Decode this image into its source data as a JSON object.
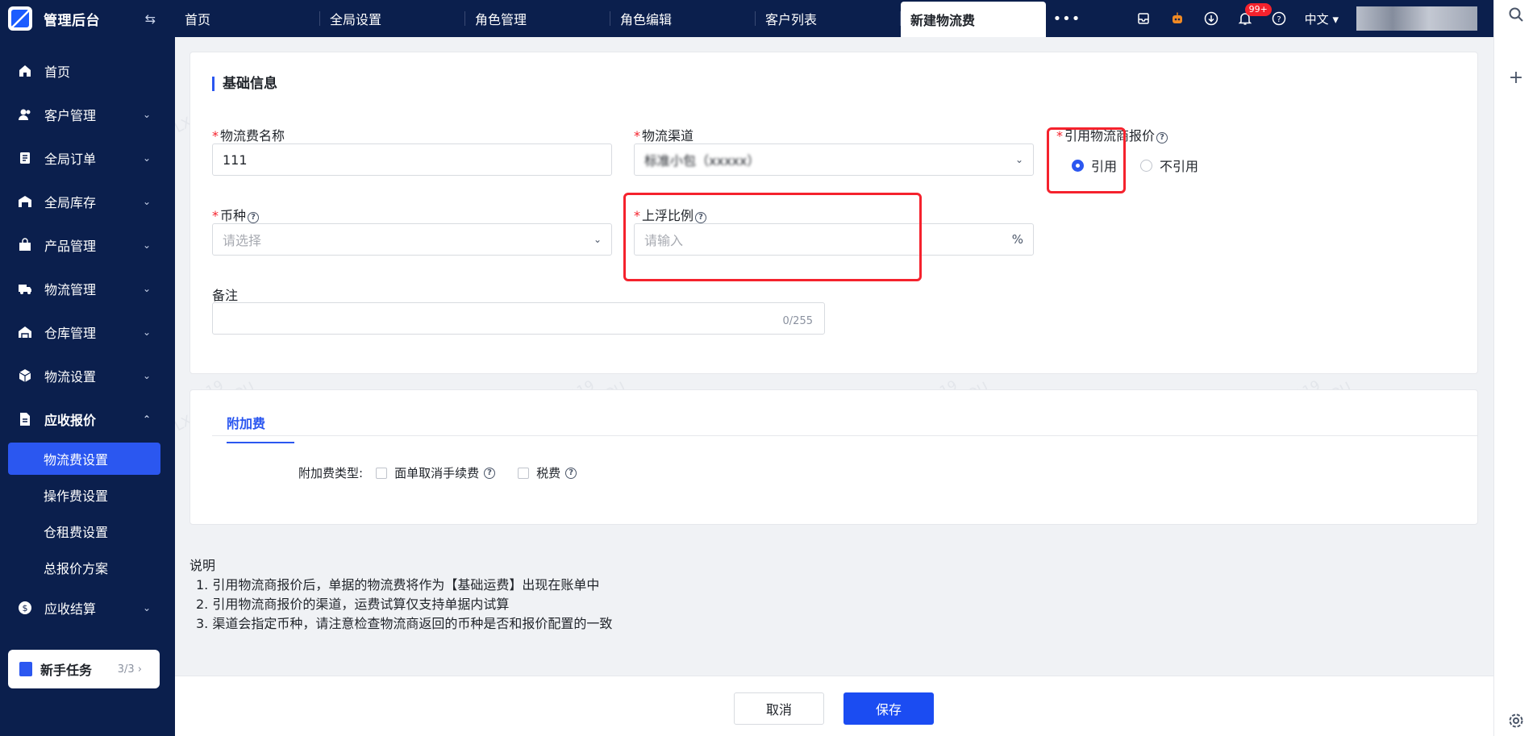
{
  "app": {
    "title": "管理后台"
  },
  "tabs": [
    {
      "label": "首页"
    },
    {
      "label": "全局设置"
    },
    {
      "label": "角色管理"
    },
    {
      "label": "角色编辑"
    },
    {
      "label": "客户列表"
    },
    {
      "label": "新建物流费",
      "active": true
    }
  ],
  "header": {
    "notification_count": "99+",
    "language": "中文"
  },
  "sidebar": {
    "items": [
      {
        "label": "首页",
        "icon": "home-icon"
      },
      {
        "label": "客户管理",
        "icon": "users-icon"
      },
      {
        "label": "全局订单",
        "icon": "order-icon"
      },
      {
        "label": "全局库存",
        "icon": "inventory-icon"
      },
      {
        "label": "产品管理",
        "icon": "product-icon"
      },
      {
        "label": "物流管理",
        "icon": "truck-icon"
      },
      {
        "label": "仓库管理",
        "icon": "warehouse-icon"
      },
      {
        "label": "物流设置",
        "icon": "box-icon"
      },
      {
        "label": "应收报价",
        "icon": "document-icon"
      },
      {
        "label": "应收结算",
        "icon": "dollar-icon"
      }
    ],
    "sub_items": [
      {
        "label": "物流费设置",
        "active": true
      },
      {
        "label": "操作费设置"
      },
      {
        "label": "仓租费设置"
      },
      {
        "label": "总报价方案"
      }
    ],
    "newbie": {
      "label": "新手任务",
      "count": "3/3"
    }
  },
  "form": {
    "section_title": "基础信息",
    "name_label": "物流费名称",
    "name_value": "111",
    "channel_label": "物流渠道",
    "channel_value": "标准小包（xxxxx）",
    "quote_label": "引用物流商报价",
    "quote_yes": "引用",
    "quote_no": "不引用",
    "currency_label": "币种",
    "currency_placeholder": "请选择",
    "markup_label": "上浮比例",
    "markup_placeholder": "请输入",
    "markup_suffix": "%",
    "remark_label": "备注",
    "remark_count": "0/255"
  },
  "surcharge": {
    "tab": "附加费",
    "type_label": "附加费类型:",
    "option1": "面单取消手续费",
    "option2": "税费"
  },
  "notes": {
    "title": "说明",
    "items": [
      "1. 引用物流商报价后，单据的物流费将作为【基础运费】出现在账单中",
      "2. 引用物流商报价的渠道，运费试算仅支持单据内试算",
      "3. 渠道会指定币种，请注意检查物流商返回的币种是否和报价配置的一致"
    ]
  },
  "actions": {
    "cancel": "取消",
    "save": "保存"
  },
  "watermark": {
    "line1": "8119",
    "line2": "LXSHOUHOU"
  },
  "colors": {
    "primary": "#2b57f0",
    "nav_bg": "#0b1f4d",
    "highlight": "#f5222d"
  }
}
